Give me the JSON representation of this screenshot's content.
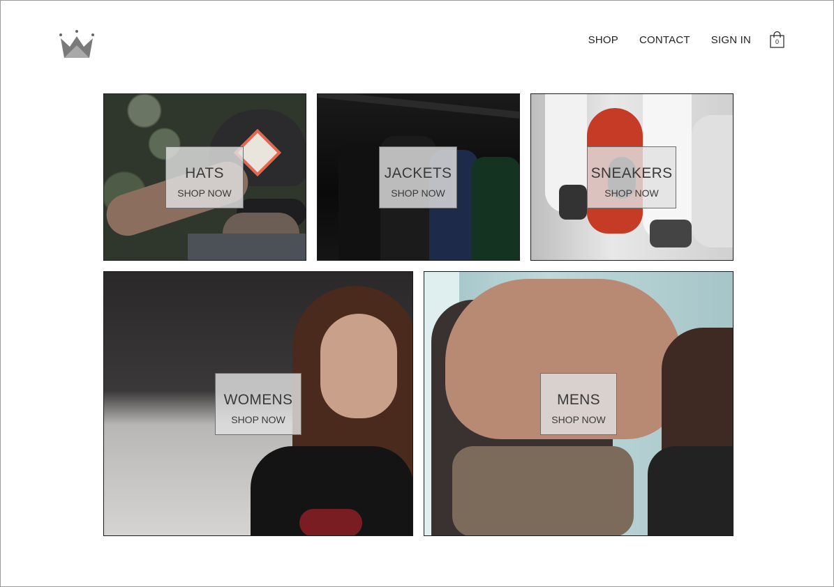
{
  "nav": {
    "links": [
      "SHOP",
      "CONTACT",
      "SIGN IN"
    ],
    "cart_count": "0"
  },
  "tiles": [
    {
      "title": "HATS",
      "cta": "SHOP NOW"
    },
    {
      "title": "JACKETS",
      "cta": "SHOP NOW"
    },
    {
      "title": "SNEAKERS",
      "cta": "SHOP NOW"
    },
    {
      "title": "WOMENS",
      "cta": "SHOP NOW"
    },
    {
      "title": "MENS",
      "cta": "SHOP NOW"
    }
  ]
}
